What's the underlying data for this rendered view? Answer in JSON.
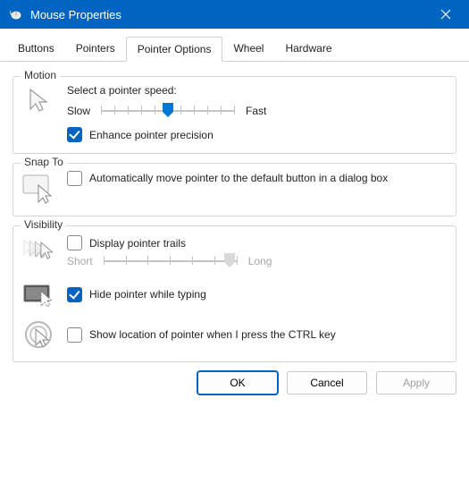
{
  "window": {
    "title": "Mouse Properties"
  },
  "tabs": {
    "buttons": "Buttons",
    "pointers": "Pointers",
    "pointer_options": "Pointer Options",
    "wheel": "Wheel",
    "hardware": "Hardware"
  },
  "motion": {
    "group": "Motion",
    "select_speed": "Select a pointer speed:",
    "slow": "Slow",
    "fast": "Fast",
    "enhance": "Enhance pointer precision"
  },
  "snapto": {
    "group": "Snap To",
    "auto_move": "Automatically move pointer to the default button in a dialog box"
  },
  "visibility": {
    "group": "Visibility",
    "trails": "Display pointer trails",
    "short": "Short",
    "long": "Long",
    "hide_typing": "Hide pointer while typing",
    "show_ctrl": "Show location of pointer when I press the CTRL key"
  },
  "buttons": {
    "ok": "OK",
    "cancel": "Cancel",
    "apply": "Apply"
  }
}
